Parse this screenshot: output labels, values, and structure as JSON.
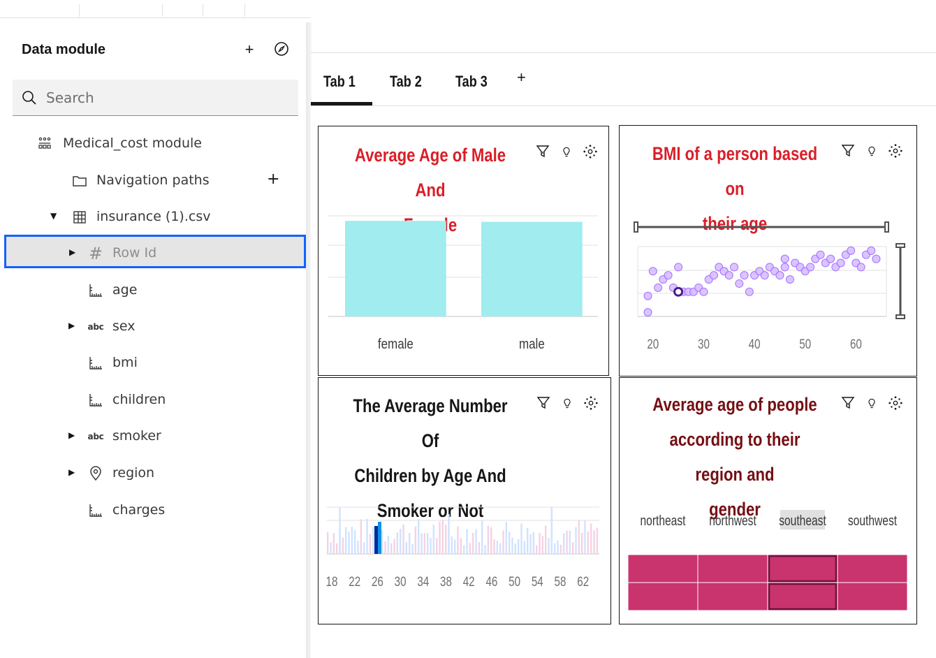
{
  "panel": {
    "title": "Data module",
    "search_placeholder": "Search",
    "tree": [
      {
        "label": "Medical_cost module",
        "icon": "module-icon"
      },
      {
        "label": "Navigation paths",
        "icon": "folder-icon"
      },
      {
        "label": "insurance (1).csv",
        "icon": "table-icon"
      },
      {
        "label": "Row Id",
        "icon": "hash-icon"
      },
      {
        "label": "age",
        "icon": "measure-icon"
      },
      {
        "label": "sex",
        "icon": "abc-icon"
      },
      {
        "label": "bmi",
        "icon": "measure-icon"
      },
      {
        "label": "children",
        "icon": "measure-icon"
      },
      {
        "label": "smoker",
        "icon": "abc-icon"
      },
      {
        "label": "region",
        "icon": "location-icon"
      },
      {
        "label": "charges",
        "icon": "measure-icon"
      }
    ],
    "abc_text": "abc",
    "hash_text": "#"
  },
  "tabs": [
    {
      "label": "Tab 1"
    },
    {
      "label": "Tab 2"
    },
    {
      "label": "Tab 3"
    }
  ],
  "tab_add": "+",
  "cards": {
    "c1": {
      "title_line1": "Average Age of Male And",
      "title_line2": "Female",
      "color": "#da1e28"
    },
    "c2": {
      "title_line1": "BMI of a person based on",
      "title_line2": "their age",
      "color": "#da1e28"
    },
    "c3": {
      "title_line1": "The Average Number Of",
      "title_line2": "Children by Age And",
      "title_line3": "Smoker or Not",
      "color": "#161616"
    },
    "c4": {
      "title_line1": "Average age of people",
      "title_line2": "according to their region and",
      "title_line3": "gender",
      "color": "#750e13"
    }
  },
  "colors": {
    "accent": "#0f62fe",
    "bar_cyan": "#a0ecee",
    "point_purple": "#d4bbff",
    "heat_pink": "#c9336e"
  },
  "chart_data": [
    {
      "type": "bar",
      "categories": [
        "female",
        "male"
      ],
      "values": [
        39.5,
        39.1
      ],
      "grid": true
    },
    {
      "type": "scatter",
      "x_ticks": [
        "20",
        "30",
        "40",
        "50",
        "60"
      ],
      "xlim": [
        17,
        66
      ],
      "points": [
        [
          20,
          32
        ],
        [
          21,
          28
        ],
        [
          19,
          22
        ],
        [
          22,
          30
        ],
        [
          23,
          31
        ],
        [
          24,
          28
        ],
        [
          25,
          27
        ],
        [
          26,
          27
        ],
        [
          27,
          27
        ],
        [
          28,
          27
        ],
        [
          29,
          28
        ],
        [
          30,
          27
        ],
        [
          31,
          30
        ],
        [
          32,
          31
        ],
        [
          33,
          33
        ],
        [
          34,
          32
        ],
        [
          35,
          31
        ],
        [
          36,
          33
        ],
        [
          37,
          29
        ],
        [
          38,
          31
        ],
        [
          39,
          27
        ],
        [
          40,
          31
        ],
        [
          41,
          32
        ],
        [
          42,
          31
        ],
        [
          43,
          33
        ],
        [
          44,
          32
        ],
        [
          45,
          31
        ],
        [
          46,
          33
        ],
        [
          47,
          30
        ],
        [
          48,
          34
        ],
        [
          49,
          33
        ],
        [
          50,
          32
        ],
        [
          51,
          33
        ],
        [
          52,
          35
        ],
        [
          53,
          36
        ],
        [
          54,
          34
        ],
        [
          55,
          35
        ],
        [
          56,
          33
        ],
        [
          57,
          34
        ],
        [
          58,
          36
        ],
        [
          59,
          37
        ],
        [
          60,
          34
        ],
        [
          61,
          33
        ],
        [
          62,
          36
        ],
        [
          63,
          37
        ],
        [
          64,
          35
        ],
        [
          19,
          26
        ],
        [
          46,
          35
        ],
        [
          25,
          33
        ]
      ]
    },
    {
      "type": "bar",
      "x_ticks": [
        "18",
        "22",
        "26",
        "30",
        "34",
        "38",
        "42",
        "46",
        "50",
        "54",
        "58",
        "62"
      ],
      "grid": true
    },
    {
      "type": "heatmap",
      "categories": [
        "northeast",
        "northwest",
        "southeast",
        "southwest"
      ],
      "rows": 2,
      "values": [
        [
          39,
          39,
          38,
          39
        ],
        [
          39,
          39,
          38,
          39
        ]
      ],
      "highlight": "southeast"
    }
  ]
}
